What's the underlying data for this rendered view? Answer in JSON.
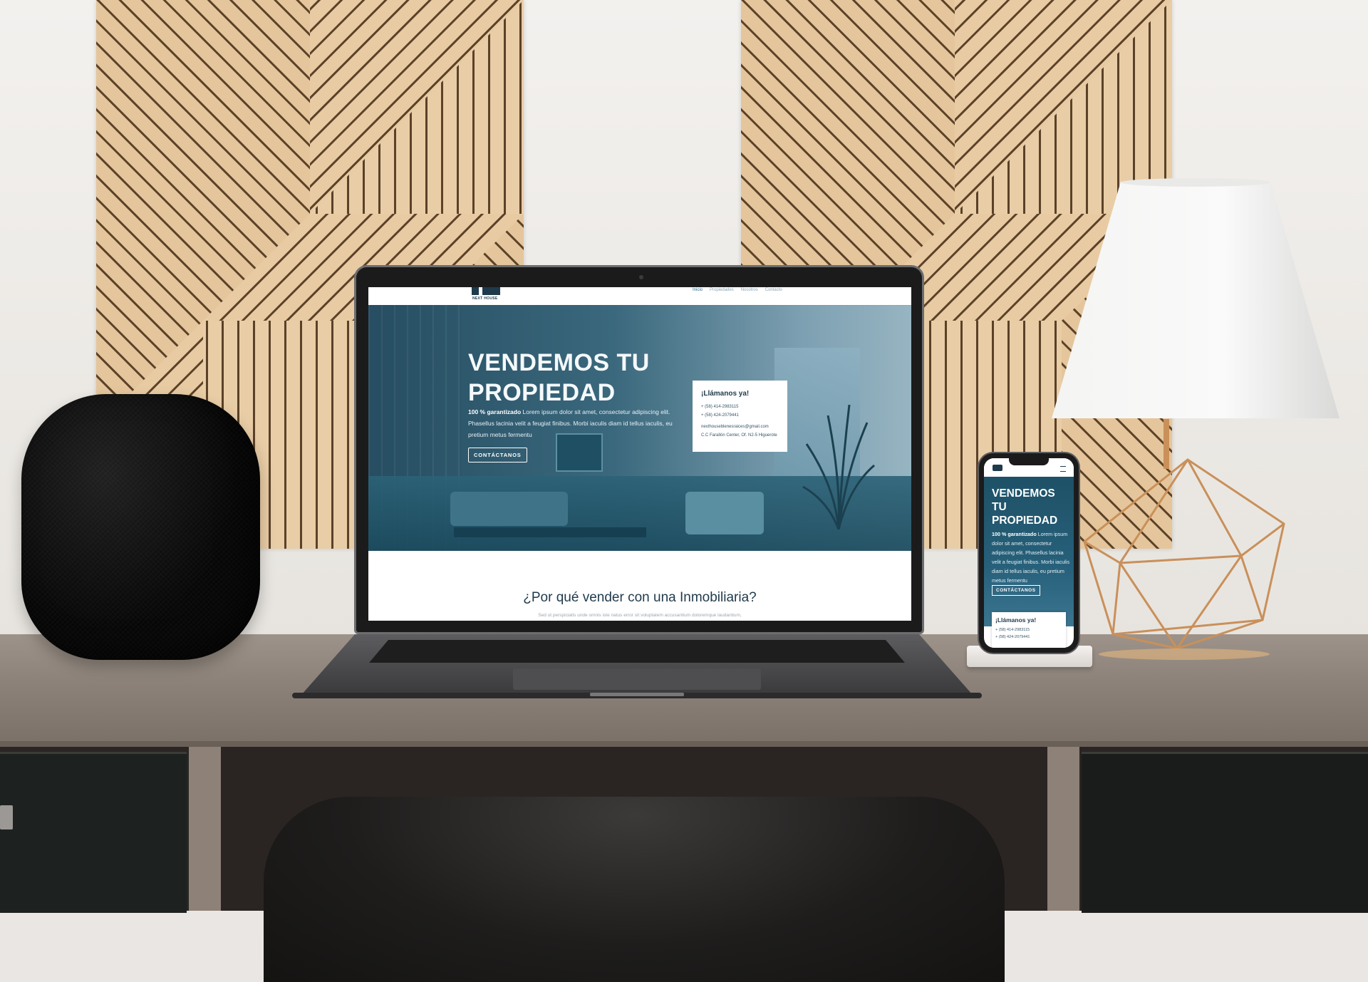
{
  "laptop_site": {
    "logo_text": "NEXT HOUSE",
    "nav": [
      "Inicio",
      "Propiedades",
      "Nosotros",
      "Contacto"
    ],
    "hero": {
      "title": "VENDEMOS TU PROPIEDAD",
      "desc_bold": "100 % garantizado",
      "desc": "Lorem ipsum dolor sit amet, consectetur adipiscing elit. Phasellus lacinia velit a feugiat finibus. Morbi iaculis diam id tellus iaculis, eu pretium metus fermentu",
      "button": "CONTÁCTANOS"
    },
    "contact_card": {
      "title": "¡Llámanos ya!",
      "phone1": "+ (58) 414-2983115",
      "phone2": "+ (58) 424-2079441",
      "email": "nexthouseblenesraices@gmail.com",
      "address": "C.C Farallón Center, Of. N2-5 Higuerote"
    },
    "section": {
      "title": "¿Por qué vender con una Inmobiliaria?",
      "subtitle": "Sed ut perspiciatis unde omnis iste natus error sit voluptatem accusantium doloremque laudantium,"
    }
  },
  "phone_site": {
    "hero": {
      "title": "VENDEMOS TU PROPIEDAD",
      "desc_bold": "100 % garantizado",
      "desc": "Lorem ipsum dolor sit amet, consectetur adipiscing elit. Phasellus lacinia velit a feugiat finibus. Morbi iaculis diam id tellus iaculis, eu pretium metus fermentu",
      "button": "CONTÁCTANOS"
    },
    "contact_card": {
      "title": "¡Llámanos ya!",
      "phone1": "+ (58) 414-2983115",
      "phone2": "+ (58) 424-2079441"
    }
  },
  "colors": {
    "brand_dark": "#1f3a4b",
    "hero_teal": "#1a4f67",
    "wood": "#e6c9a0",
    "lamp_gold": "#c9905a"
  },
  "icons": [
    "hamburger-menu-icon",
    "house-logo-icon"
  ]
}
